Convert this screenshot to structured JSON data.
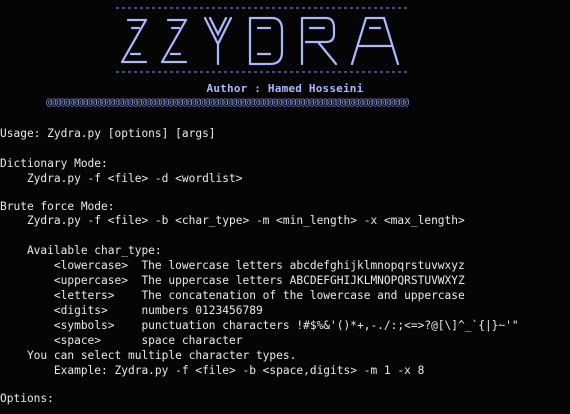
{
  "author_line": "Author : Hamed Hosseini",
  "divider": "@@@@@@@@@@@@@@@@@@@@@@@@@@@@@@@@@@@@@@@@@@@@@@@@@@@@@@@@@@@@@@@@@@@@@@@@@@@@@@@@",
  "usage": "Usage: Zydra.py [options] [args]",
  "dictionary_header": "Dictionary Mode:",
  "dictionary_cmd": "    Zydra.py -f <file> -d <wordlist>",
  "brute_header": "Brute force Mode:",
  "brute_cmd": "    Zydra.py -f <file> -b <char_type> -m <min_length> -x <max_length>",
  "char_type_header": "    Available char_type:",
  "char_types": [
    {
      "line": "        <lowercase>  The lowercase letters abcdefghijklmnopqrstuvwxyz"
    },
    {
      "line": "        <uppercase>  The uppercase letters ABCDEFGHIJKLMNOPQRSTUVWXYZ"
    },
    {
      "line": "        <letters>    The concatenation of the lowercase and uppercase"
    },
    {
      "line": "        <digits>     numbers 0123456789"
    },
    {
      "line": "        <symbols>    punctuation characters !#$%&'()*+,-./:;<=>?@[\\]^_`{|}~'\""
    },
    {
      "line": "        <space>      space character"
    }
  ],
  "multiple_note": "    You can select multiple character types.",
  "example": "        Example: Zydra.py -f <file> -b <space,digits> -m 1 -x 8",
  "options_header": "Options:",
  "colors": {
    "background": "#050505",
    "banner": "#a9b8ff",
    "text": "#e9e9e9"
  }
}
